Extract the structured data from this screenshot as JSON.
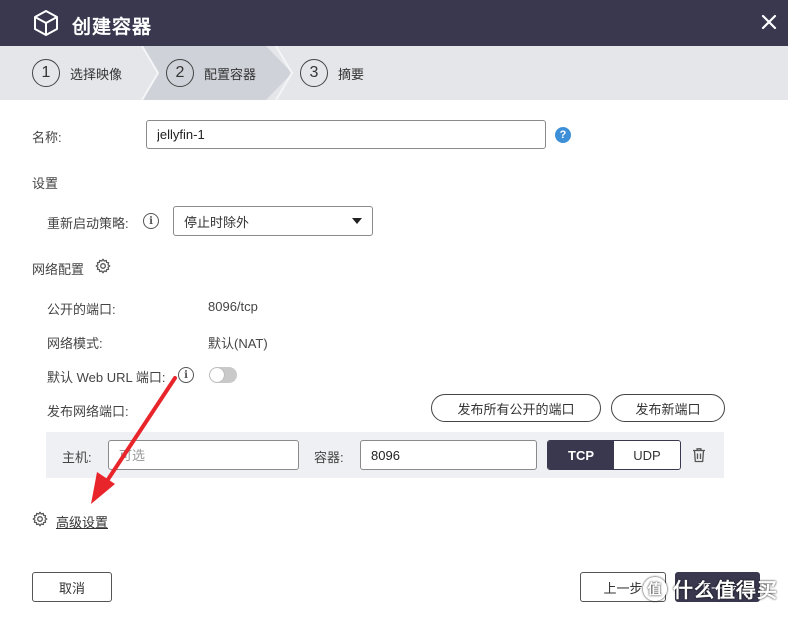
{
  "dialog": {
    "title": "创建容器",
    "logo_icon": "cube-icon",
    "close_icon": "close-icon"
  },
  "steps": [
    {
      "num": "1",
      "label": "选择映像"
    },
    {
      "num": "2",
      "label": "配置容器"
    },
    {
      "num": "3",
      "label": "摘要"
    }
  ],
  "name_field": {
    "label": "名称:",
    "value": "jellyfin-1",
    "help": "?"
  },
  "settings": {
    "heading": "设置",
    "restart_label": "重新启动策略:",
    "restart_value": "停止时除外",
    "info": "i"
  },
  "network": {
    "heading": "网络配置",
    "exposed_ports_label": "公开的端口:",
    "exposed_ports_value": "8096/tcp",
    "mode_label": "网络模式:",
    "mode_value": "默认(NAT)",
    "web_url_label": "默认 Web URL 端口:",
    "publish_label": "发布网络端口:",
    "publish_all_button": "发布所有公开的端口",
    "new_port_button": "发布新端口",
    "port_row": {
      "host_label": "主机:",
      "host_placeholder": "可选",
      "container_label": "容器:",
      "container_value": "8096",
      "tcp": "TCP",
      "udp": "UDP"
    }
  },
  "advanced_link": "高级设置",
  "footer": {
    "cancel": "取消",
    "previous": "上一步",
    "next": "下一步"
  },
  "watermark": {
    "glyph": "值",
    "text": "什么值得买"
  },
  "colors": {
    "titlebar": "#39384f",
    "steps_bg": "#e4e6ea",
    "help_blue": "#3d8fd8",
    "arrow_red": "#e8252b"
  }
}
